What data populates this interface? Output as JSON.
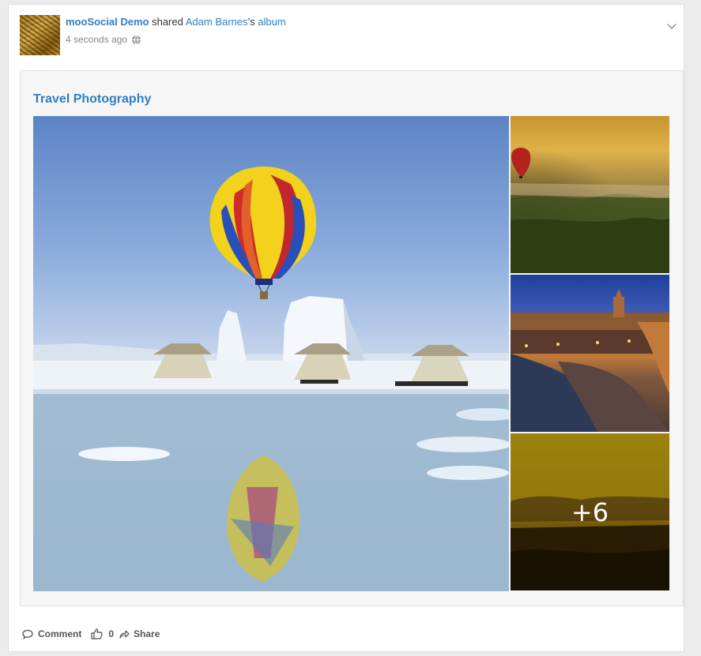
{
  "post": {
    "owner": "mooSocial Demo",
    "action": "shared",
    "target_user": "Adam Barnes",
    "possessive": "’s",
    "object": "album",
    "time": "4 seconds ago"
  },
  "album": {
    "title": "Travel Photography",
    "more_count": "+6"
  },
  "actions": {
    "comment_label": "Comment",
    "like_count": "0",
    "share_label": "Share"
  },
  "icons": {
    "privacy": "globe-icon",
    "menu": "chevron-down-icon",
    "comment": "comment-icon",
    "like": "thumbs-up-icon",
    "share": "share-arrow-icon"
  },
  "colors": {
    "link": "#2f7ebf",
    "meta": "#888888"
  }
}
